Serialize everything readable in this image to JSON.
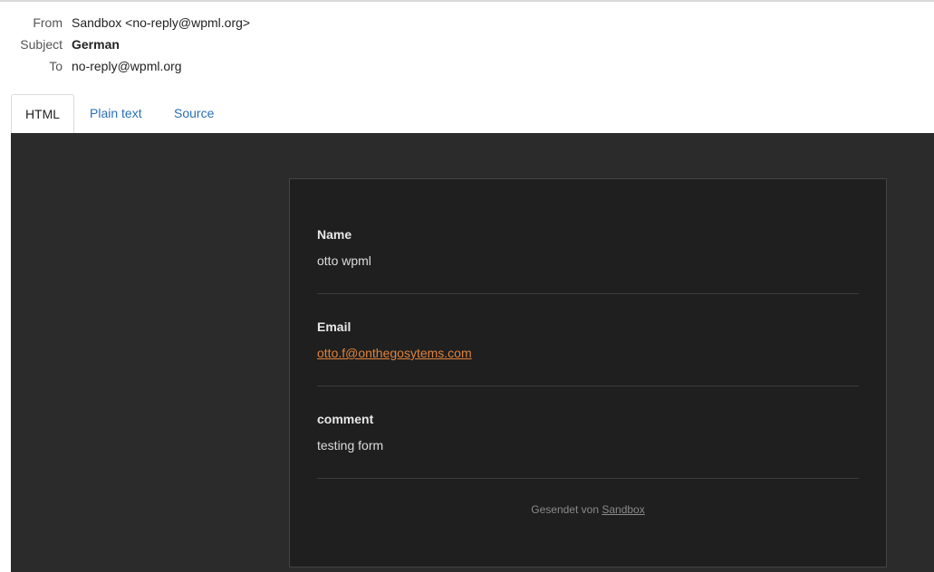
{
  "headers": {
    "from_label": "From",
    "from_value": "Sandbox <no-reply@wpml.org>",
    "subject_label": "Subject",
    "subject_value": "German",
    "to_label": "To",
    "to_value": "no-reply@wpml.org"
  },
  "tabs": [
    {
      "label": "HTML",
      "active": true
    },
    {
      "label": "Plain text",
      "active": false
    },
    {
      "label": "Source",
      "active": false
    }
  ],
  "email": {
    "fields": [
      {
        "label": "Name",
        "value": "otto wpml"
      },
      {
        "label": "Email",
        "value": "otto.f@onthegosytems.com"
      },
      {
        "label": "comment",
        "value": "testing form"
      }
    ],
    "footer_prefix": "Gesendet von",
    "footer_link": "Sandbox"
  },
  "colors": {
    "link_blue": "#2a6fb8",
    "preview_bg": "#2b2b2c",
    "card_bg": "#1f1f1f",
    "email_link": "#e0823a"
  }
}
